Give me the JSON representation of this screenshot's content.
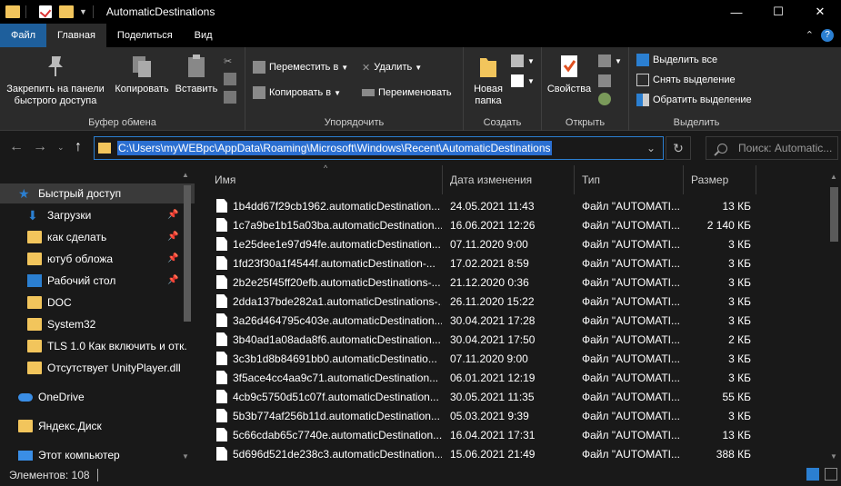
{
  "window": {
    "title": "AutomaticDestinations",
    "controls": [
      "—",
      "☐",
      "✕"
    ]
  },
  "ribbon_tabs": [
    "Файл",
    "Главная",
    "Поделиться",
    "Вид"
  ],
  "ribbon": {
    "clipboard": {
      "label": "Буфер обмена",
      "pin_label": "Закрепить на панели быстрого доступа",
      "pin_line1": "Закрепить на панели",
      "pin_line2": "быстрого доступа",
      "copy": "Копировать",
      "paste": "Вставить"
    },
    "organize": {
      "label": "Упорядочить",
      "move_to": "Переместить в",
      "copy_to": "Копировать в",
      "delete": "Удалить",
      "rename": "Переименовать"
    },
    "create": {
      "label": "Создать",
      "new_folder_line1": "Новая",
      "new_folder_line2": "папка"
    },
    "open": {
      "label": "Открыть",
      "properties": "Свойства"
    },
    "select": {
      "label": "Выделить",
      "select_all": "Выделить все",
      "select_none": "Снять выделение",
      "invert": "Обратить выделение"
    }
  },
  "address": {
    "path": "C:\\Users\\myWEBpc\\AppData\\Roaming\\Microsoft\\Windows\\Recent\\AutomaticDestinations",
    "search_placeholder": "Поиск: Automatic..."
  },
  "sidebar": {
    "items": [
      {
        "label": "Быстрый доступ",
        "icon": "star-icon"
      },
      {
        "label": "Загрузки",
        "icon": "download-icon",
        "pinned": true
      },
      {
        "label": "как сделать",
        "icon": "folder-icon",
        "pinned": true
      },
      {
        "label": "ютуб обложа",
        "icon": "folder-icon",
        "pinned": true
      },
      {
        "label": "Рабочий стол",
        "icon": "desktop-icon",
        "pinned": true
      },
      {
        "label": "DOC",
        "icon": "folder-icon"
      },
      {
        "label": "System32",
        "icon": "folder-icon"
      },
      {
        "label": "TLS 1.0 Как включить и отк.",
        "icon": "folder-icon"
      },
      {
        "label": "Отсутствует UnityPlayer.dll",
        "icon": "folder-icon"
      },
      {
        "label": "OneDrive",
        "icon": "cloud-icon"
      },
      {
        "label": "Яндекс.Диск",
        "icon": "yandex-disk-icon"
      },
      {
        "label": "Этот компьютер",
        "icon": "computer-icon"
      }
    ]
  },
  "columns": [
    "Имя",
    "Дата изменения",
    "Тип",
    "Размер"
  ],
  "files": [
    {
      "name": "1b4dd67f29cb1962.automaticDestination...",
      "date": "24.05.2021 11:43",
      "type": "Файл \"AUTOMATI...",
      "size": "13 КБ"
    },
    {
      "name": "1c7a9be1b15a03ba.automaticDestination...",
      "date": "16.06.2021 12:26",
      "type": "Файл \"AUTOMATI...",
      "size": "2 140 КБ"
    },
    {
      "name": "1e25dee1e97d94fe.automaticDestination...",
      "date": "07.11.2020 9:00",
      "type": "Файл \"AUTOMATI...",
      "size": "3 КБ"
    },
    {
      "name": "1fd23f30a1f4544f.automaticDestination-...",
      "date": "17.02.2021 8:59",
      "type": "Файл \"AUTOMATI...",
      "size": "3 КБ"
    },
    {
      "name": "2b2e25f45ff20efb.automaticDestinations-...",
      "date": "21.12.2020 0:36",
      "type": "Файл \"AUTOMATI...",
      "size": "3 КБ"
    },
    {
      "name": "2dda137bde282a1.automaticDestinations-...",
      "date": "26.11.2020 15:22",
      "type": "Файл \"AUTOMATI...",
      "size": "3 КБ"
    },
    {
      "name": "3a26d464795c403e.automaticDestination...",
      "date": "30.04.2021 17:28",
      "type": "Файл \"AUTOMATI...",
      "size": "3 КБ"
    },
    {
      "name": "3b40ad1a08ada8f6.automaticDestination...",
      "date": "30.04.2021 17:50",
      "type": "Файл \"AUTOMATI...",
      "size": "2 КБ"
    },
    {
      "name": "3c3b1d8b84691bb0.automaticDestinatio...",
      "date": "07.11.2020 9:00",
      "type": "Файл \"AUTOMATI...",
      "size": "3 КБ"
    },
    {
      "name": "3f5ace4cc4aa9c71.automaticDestination...",
      "date": "06.01.2021 12:19",
      "type": "Файл \"AUTOMATI...",
      "size": "3 КБ"
    },
    {
      "name": "4cb9c5750d51c07f.automaticDestination...",
      "date": "30.05.2021 11:35",
      "type": "Файл \"AUTOMATI...",
      "size": "55 КБ"
    },
    {
      "name": "5b3b774af256b11d.automaticDestination...",
      "date": "05.03.2021 9:39",
      "type": "Файл \"AUTOMATI...",
      "size": "3 КБ"
    },
    {
      "name": "5c66cdab65c7740e.automaticDestination...",
      "date": "16.04.2021 17:31",
      "type": "Файл \"AUTOMATI...",
      "size": "13 КБ"
    },
    {
      "name": "5d696d521de238c3.automaticDestination...",
      "date": "15.06.2021 21:49",
      "type": "Файл \"AUTOMATI...",
      "size": "388 КБ"
    }
  ],
  "status": {
    "items_count": "Элементов: 108"
  },
  "colors": {
    "accent": "#2b7fd1",
    "folder": "#f2c55c",
    "background": "#191919",
    "ribbon": "#2b2b2b"
  }
}
